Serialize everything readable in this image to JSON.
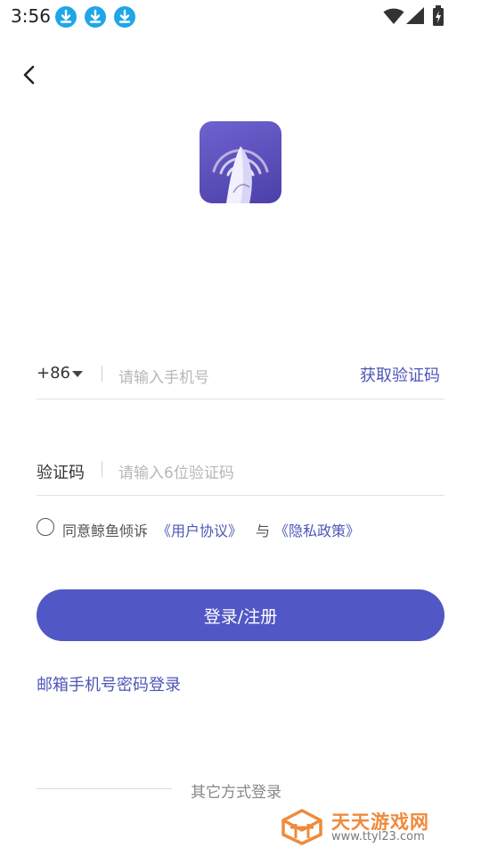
{
  "status_bar": {
    "time": "3:56",
    "notification_icons": [
      "download-icon",
      "download-icon",
      "download-icon"
    ],
    "system_icons": [
      "wifi-icon",
      "signal-icon",
      "battery-icon"
    ]
  },
  "nav": {
    "back_icon": "chevron-left-icon"
  },
  "logo": {
    "icon": "whale-tail-app-logo"
  },
  "phone": {
    "country_code": "+86",
    "placeholder": "请输入手机号",
    "get_code_label": "获取验证码"
  },
  "code": {
    "label": "验证码",
    "placeholder": "请输入6位验证码"
  },
  "agreement": {
    "checked": false,
    "prefix": "同意鲸鱼倾诉",
    "user_agreement": "《用户协议》",
    "conjunction": "与",
    "privacy_policy": "《隐私政策》"
  },
  "login_button": "登录/注册",
  "password_login_link": "邮箱手机号密码登录",
  "other_methods": "其它方式登录",
  "watermark": {
    "title": "天天游戏网",
    "url": "www.ttyl23.com"
  },
  "colors": {
    "accent": "#5157c5",
    "link": "#4d56b8",
    "logo_gradient_start": "#6f62cf",
    "logo_gradient_end": "#4b3fa8",
    "watermark": "#f08a3c",
    "download_badge": "#1fa6e8"
  }
}
